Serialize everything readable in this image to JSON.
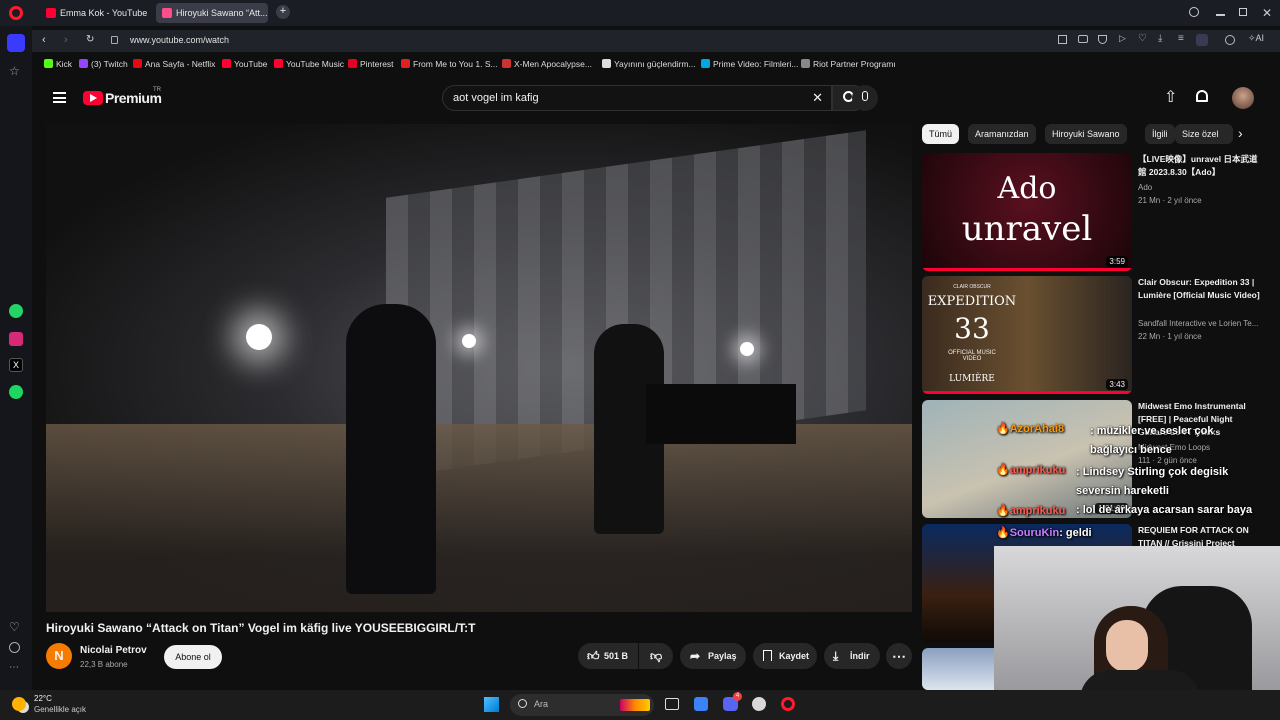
{
  "browser": {
    "tabs": [
      {
        "label": "Emma Kok - YouTube"
      },
      {
        "label": "Hiroyuki Sawano “Att..."
      }
    ],
    "new_tab": "+",
    "url": "www.youtube.com/watch",
    "ai_label": "AI",
    "bookmarks": [
      {
        "label": "Kick",
        "color": "#53fc18"
      },
      {
        "label": "(3) Twitch",
        "color": "#9146ff"
      },
      {
        "label": "Ana Sayfa - Netflix",
        "color": "#e50914"
      },
      {
        "label": "YouTube",
        "color": "#ff0033"
      },
      {
        "label": "YouTube Music",
        "color": "#ff0033"
      },
      {
        "label": "Pinterest",
        "color": "#e60023"
      },
      {
        "label": "From Me to You 1. S...",
        "color": "#d22"
      },
      {
        "label": "X-Men Apocalypse...",
        "color": "#c33"
      },
      {
        "label": "Yayınını güçlendirm...",
        "color": "#ddd"
      },
      {
        "label": "Prime Video: Filmleri...",
        "color": "#00a8e1"
      },
      {
        "label": "Riot Partner Programı",
        "color": "#888"
      }
    ]
  },
  "youtube": {
    "logo": "Premium",
    "logo_country": "TR",
    "search_query": "aot vogel im kafig",
    "video_title": "Hiroyuki Sawano “Attack on Titan” Vogel im käfig live YOUSEEBIGGIRL/T:T",
    "channel": {
      "initial": "N",
      "name": "Nicolai Petrov",
      "subscribers": "22,3 B abone",
      "subscribe_label": "Abone ol"
    },
    "actions": {
      "likes": "501 B",
      "share": "Paylaş",
      "save": "Kaydet",
      "download": "İndir"
    },
    "chips": [
      "Tümü",
      "Aramanızdan",
      "Hiroyuki Sawano",
      "İlgili",
      "Size özel"
    ],
    "related": [
      {
        "title": "【LIVE映像】unravel 日本武道館 2023.8.30【Ado】",
        "channel": "Ado",
        "meta": "21 Mn · 2 yıl önce",
        "duration": "3:59",
        "thumb_line1": "Ado",
        "thumb_line2": "unravel"
      },
      {
        "title": "Clair Obscur: Expedition 33 | Lumière [Official Music Video]",
        "channel": "Sandfall Interactive ve Lorien Te...",
        "meta": "22 Mn · 1 yıl önce",
        "duration": "3:43",
        "thumb_small": "CLAIR OBSCUR",
        "thumb_line1": "EXPEDITION",
        "thumb_line2": "33",
        "thumb_line3": "OFFICIAL MUSIC VIDEO",
        "thumb_line4": "LUMIÈRE"
      },
      {
        "title": "Midwest Emo Instrumental [FREE] | Peaceful Night Guitars Lo-Fi Tracks",
        "channel": "Midwest Emo Loops",
        "meta": "111 · 2 gün önce",
        "duration": "1:01:00"
      },
      {
        "title": "REQUIEM FOR ATTACK ON TITAN // Grissini Project"
      }
    ]
  },
  "chat": [
    {
      "name": "AzorAhai8",
      "message": ": müzikler ve sesler çok bağlayıcı bence"
    },
    {
      "name": "amprikuku",
      "message": ": Lindsey Stirling çok degisik seversin hareketli"
    },
    {
      "name": "amprikuku",
      "message": ": lol de arkaya acarsan sarar baya"
    },
    {
      "name": "SouruKin",
      "message": ": geldi"
    }
  ],
  "taskbar": {
    "temperature": "22°C",
    "weather": "Genellikle açık",
    "search_placeholder": "Ara",
    "discord_badge": "4"
  }
}
